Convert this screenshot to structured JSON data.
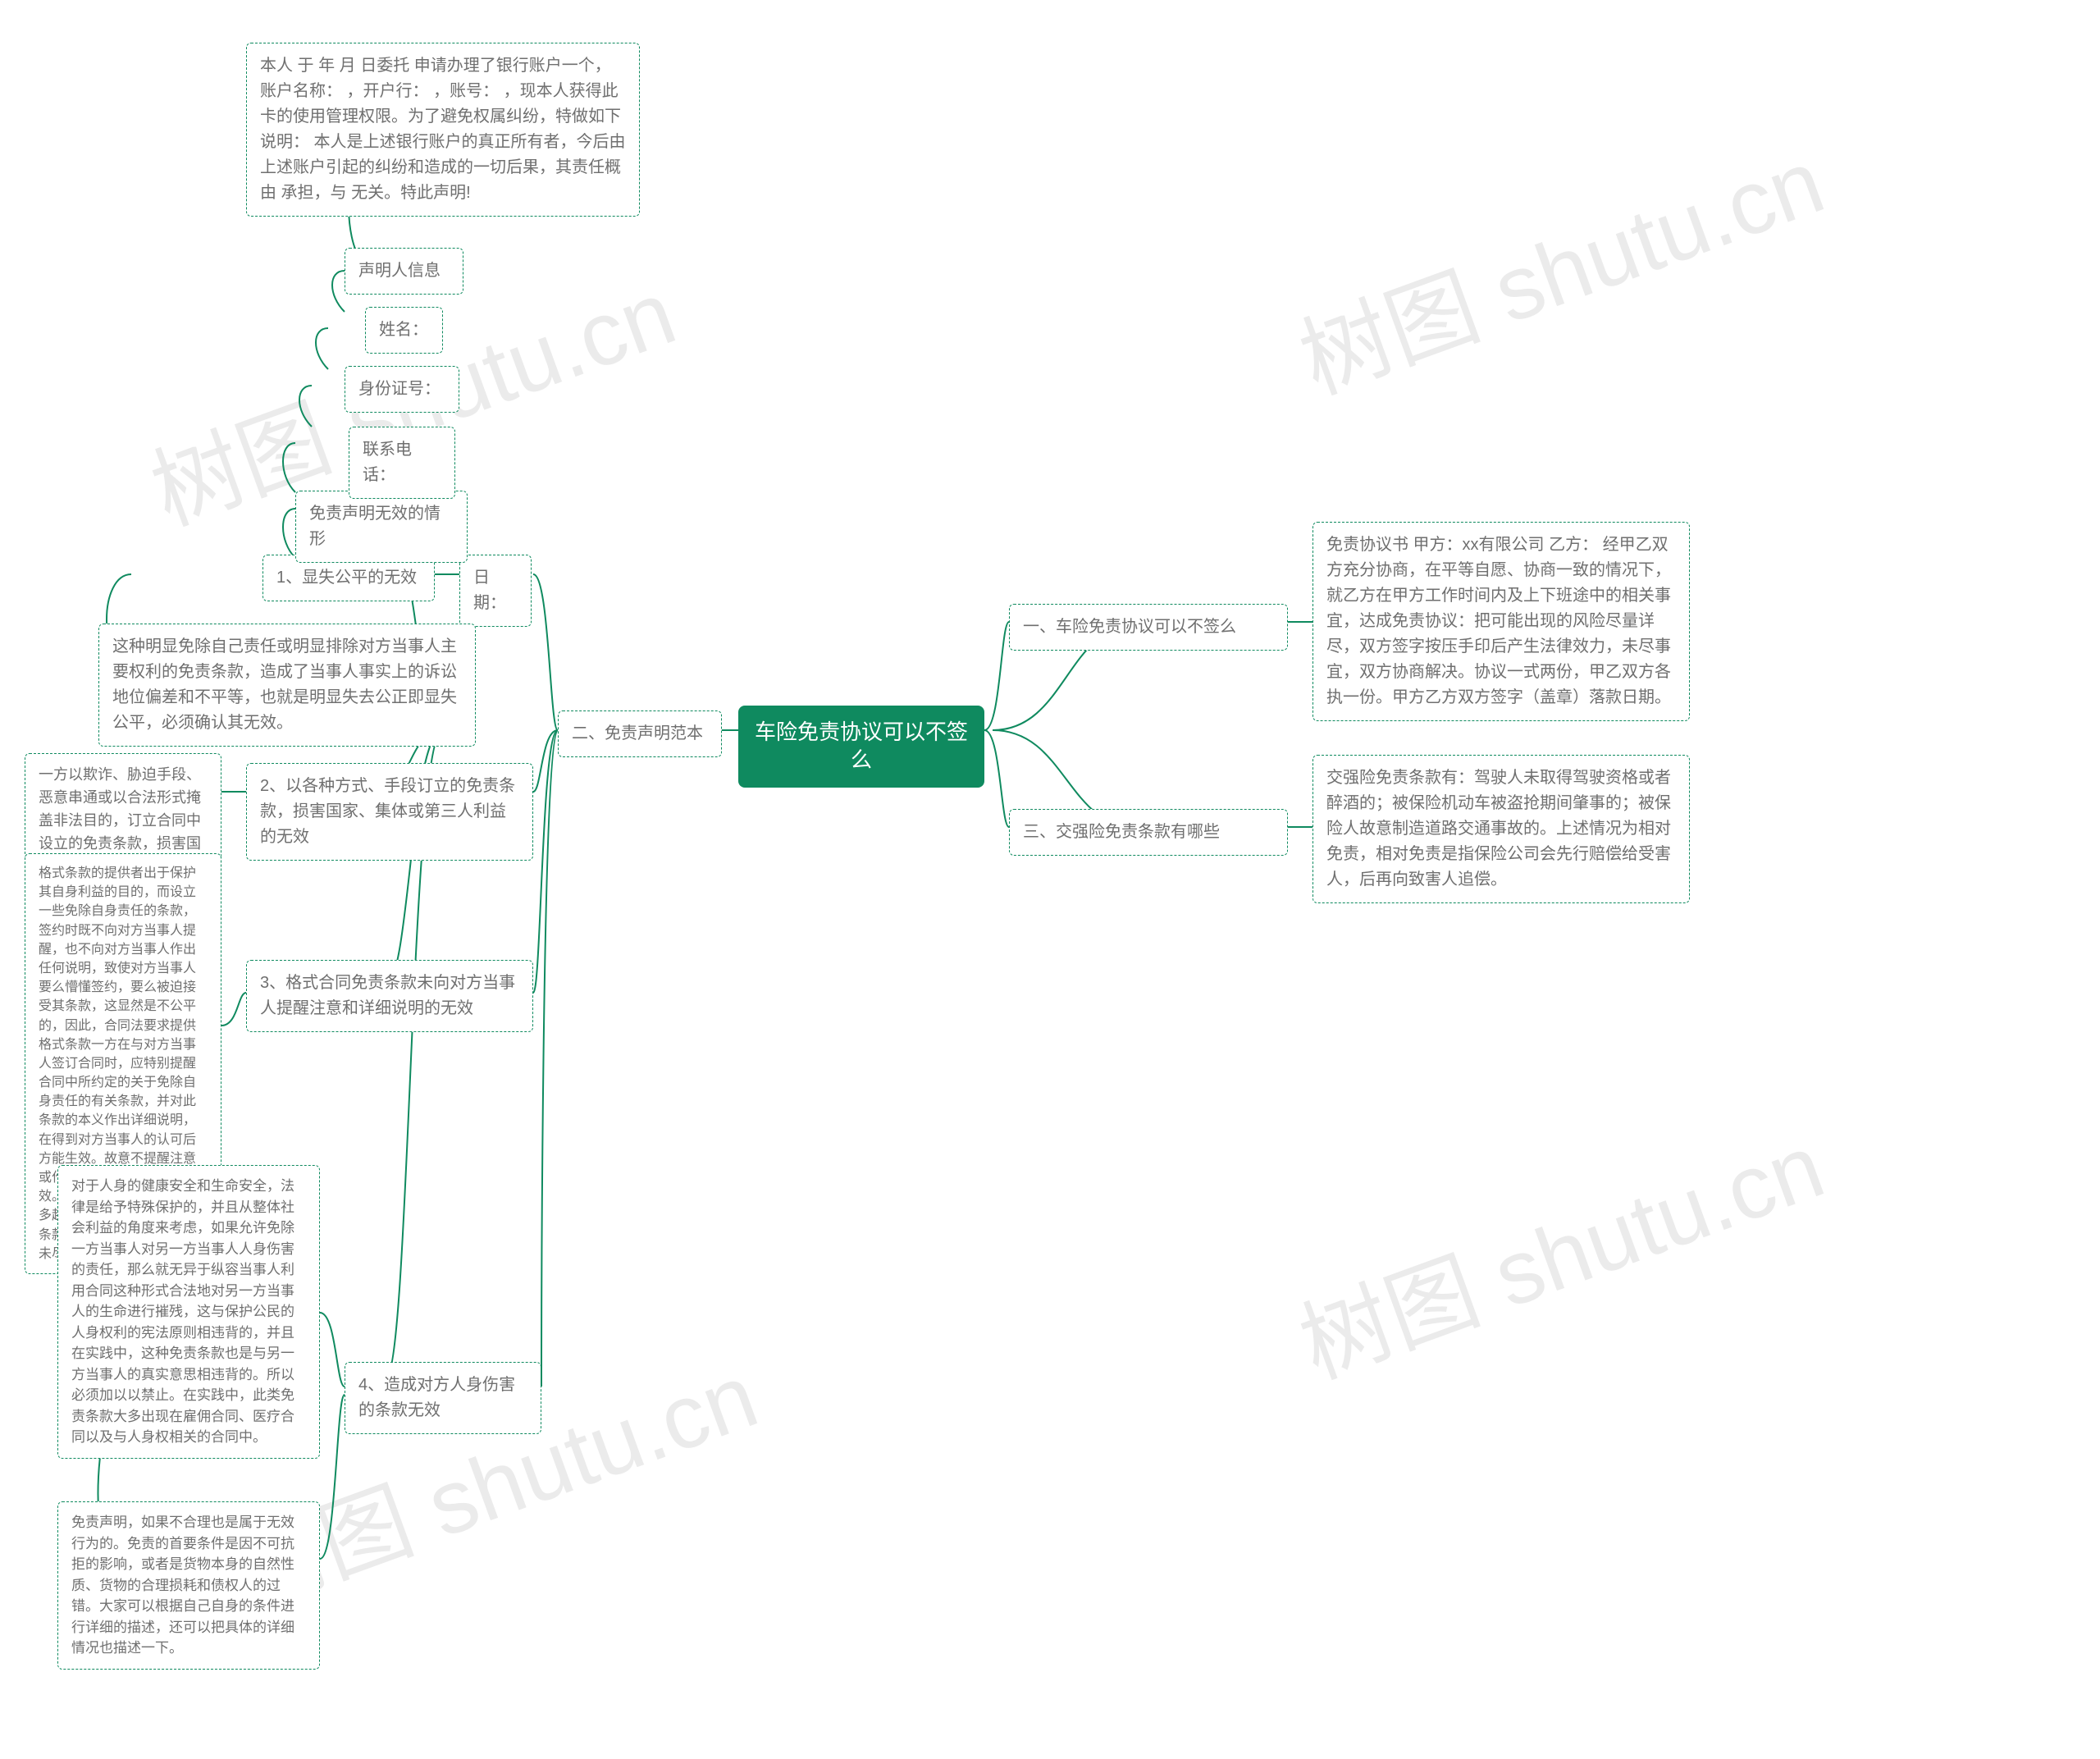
{
  "root": {
    "label": "车险免责协议可以不签么"
  },
  "right_branches": [
    {
      "id": "r1",
      "label": "一、车险免责协议可以不签么",
      "detail": "免责协议书 甲方：xx有限公司 乙方： 经甲乙双方充分协商，在平等自愿、协商一致的情况下，就乙方在甲方工作时间内及上下班途中的相关事宜，达成免责协议：把可能出现的风险尽量详尽，双方签字按压手印后产生法律效力，未尽事宜，双方协商解决。协议一式两份，甲乙双方各执一份。甲方乙方双方签字（盖章）落款日期。"
    },
    {
      "id": "r2",
      "label": "三、交强险免责条款有哪些",
      "detail": "交强险免责条款有：驾驶人未取得驾驶资格或者醉酒的；被保险机动车被盗抢期间肇事的；被保险人故意制造道路交通事故的。上述情况为相对免责，相对免责是指保险公司会先行赔偿给受害人，后再向致害人追偿。"
    }
  ],
  "left_branch": {
    "id": "l0",
    "label": "二、免责声明范本",
    "date_chain": {
      "date": "日期：",
      "items": [
        {
          "id": "lc1",
          "label": "1、显失公平的无效",
          "sub_label": "免责声明无效的情形",
          "detail": "这种明显免除自己责任或明显排除对方当事人主要权利的免责条款，造成了当事人事实上的诉讼地位偏差和不平等，也就是明显失去公正即显失公平，必须确认其无效。"
        }
      ],
      "person_info": {
        "header": "声明人信息",
        "name": "姓名：",
        "idcard": "身份证号：",
        "phone": "联系电话：",
        "note": "本人 于 年 月 日委托 申请办理了银行账户一个，账户名称： ，开户行： ，账号： ，现本人获得此卡的使用管理权限。为了避免权属纠纷，特做如下说明： 本人是上述银行账户的真正所有者，今后由上述账户引起的纠纷和造成的一切后果，其责任概由 承担，与 无关。特此声明!"
      }
    },
    "items": [
      {
        "id": "li2",
        "label": "2、以各种方式、手段订立的免责条款，损害国家、集体或第三人利益的无效",
        "detail": "一方以欺诈、胁迫手段、恶意串通或以合法形式掩盖非法目的，订立合同中设立的免责条款，损害国家、集体或第三人利益的，均属无效。"
      },
      {
        "id": "li3",
        "label": "3、格式合同免责条款未向对方当事人提醒注意和详细说明的无效",
        "detail": "格式条款的提供者出于保护其自身利益的目的，而设立一些免除自身责任的条款，签约时既不向对方当事人提醒，也不向对方当事人作出任何说明，致使对方当事人要么懵懂签约，要么被迫接受其条款，这显然是不公平的，因此，合同法要求提供格式条款一方在与对方当事人签订合同时，应特别提醒合同中所约定的关于免除自身责任的有关条款，并对此条款的本义作出详细说明，在得到对方当事人的认可后方能生效。故意不提醒注意或作出说明的，则此条款无效。去年以来，我院曾受理多起因保险合同而设立免责条款的案件，皆因保险公司未尽提醒说明义务而败诉。"
      },
      {
        "id": "li4",
        "label": "4、造成对方人身伤害的条款无效",
        "detail": "对于人身的健康安全和生命安全，法律是给予特殊保护的，并且从整体社会利益的角度来考虑，如果允许免除一方当事人对另一方当事人人身伤害的责任，那么就无异于纵容当事人利用合同这种形式合法地对另一方当事人的生命进行摧残，这与保护公民的人身权利的宪法原则相违背的，并且在实践中，这种免责条款也是与另一方当事人的真实意思相违背的。所以必须加以以禁止。在实践中，此类免责条款大多出现在雇佣合同、医疗合同以及与人身权相关的合同中。",
        "extra": "免责声明，如果不合理也是属于无效行为的。免责的首要条件是因不可抗拒的影响，或者是货物本身的自然性质、货物的合理损耗和债权人的过错。大家可以根据自己自身的条件进行详细的描述，还可以把具体的详细情况也描述一下。"
      }
    ]
  },
  "watermark": "树图 shutu.cn"
}
